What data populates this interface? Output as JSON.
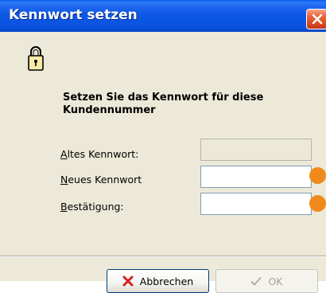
{
  "window": {
    "title": "Kennwort setzen"
  },
  "icons": {
    "title_close": "close-icon",
    "lock": "lock-icon",
    "cancel": "x-icon",
    "ok": "checkmark-icon"
  },
  "dialog": {
    "heading": "Setzen Sie das Kennwort für diese Kundennummer",
    "fields": [
      {
        "mnemonic": "A",
        "label_rest": "ltes Kennwort:",
        "value": "",
        "enabled": false
      },
      {
        "mnemonic": "N",
        "label_rest": "eues Kennwort",
        "value": "",
        "enabled": true
      },
      {
        "mnemonic": "B",
        "label_rest": "estätigung:",
        "value": "",
        "enabled": true
      }
    ]
  },
  "buttons": {
    "cancel_label": "Abbrechen",
    "ok_label": "OK"
  },
  "colors": {
    "titlebar": "#0b55e0",
    "dialog_bg": "#ece9d8",
    "marker": "#f08a1c",
    "cancel_icon": "#d91e1e"
  }
}
